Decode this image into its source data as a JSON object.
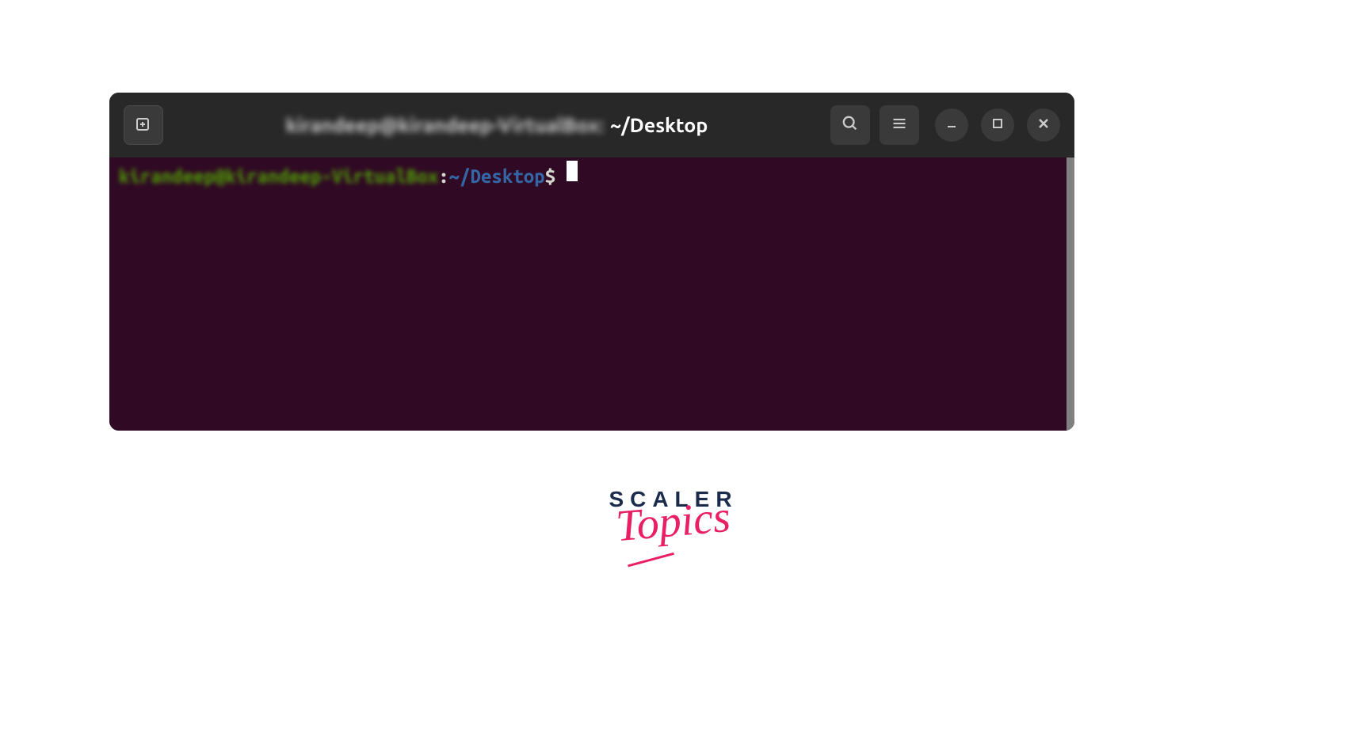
{
  "titlebar": {
    "blurred_title": "kirandeep@kirandeep-VirtualBox:",
    "path": "~/Desktop"
  },
  "terminal": {
    "prompt_user": "kirandeep@kirandeep-VirtualBox",
    "prompt_colon": ":",
    "prompt_path": "~/Desktop",
    "prompt_dollar": "$"
  },
  "icons": {
    "new_tab": "new-tab",
    "search": "search",
    "menu": "menu",
    "minimize": "minimize",
    "maximize": "maximize",
    "close": "close"
  },
  "logo": {
    "line1": "SCALER",
    "line2": "Topics"
  },
  "colors": {
    "terminal_bg": "#300a24",
    "titlebar_bg": "#282828",
    "button_bg": "#3a3a3a",
    "prompt_user": "#4e9a06",
    "prompt_path": "#3465a4",
    "prompt_text": "#d3d7cf",
    "logo_dark": "#1b2b4b",
    "logo_pink": "#e91e63"
  }
}
